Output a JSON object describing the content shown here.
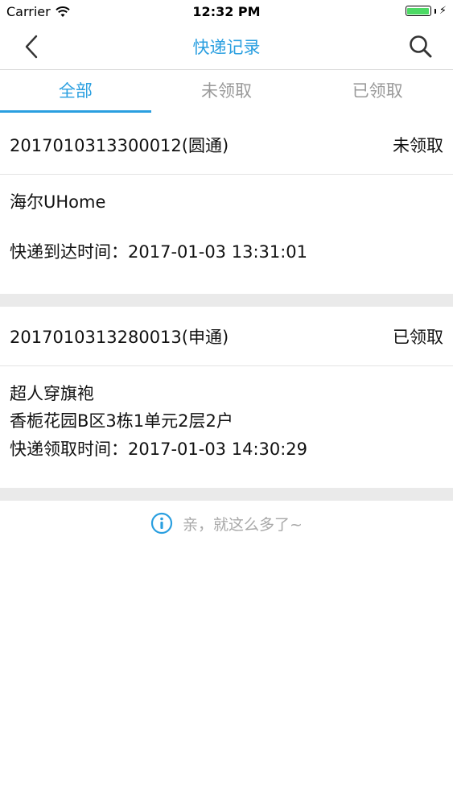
{
  "status_bar": {
    "carrier": "Carrier",
    "time": "12:32 PM"
  },
  "nav": {
    "title": "快递记录",
    "back_icon": "chevron-left-icon",
    "search_icon": "search-icon"
  },
  "tabs": [
    {
      "label": "全部",
      "active": true
    },
    {
      "label": "未领取",
      "active": false
    },
    {
      "label": "已领取",
      "active": false
    }
  ],
  "records": [
    {
      "id": "2017010313300012(圆通)",
      "status": "未领取",
      "name": "海尔UHome",
      "address": "",
      "time_label": "快递到达时间：",
      "time_value": "2017-01-03 13:31:01"
    },
    {
      "id": "2017010313280013(申通)",
      "status": "已领取",
      "name": "超人穿旗袍",
      "address": "香栀花园B区3栋1单元2层2户",
      "time_label": "快递领取时间：",
      "time_value": "2017-01-03 14:30:29"
    }
  ],
  "footer": {
    "end_text": "亲，就这么多了~",
    "icon": "info-icon"
  },
  "colors": {
    "accent": "#2a9fe0",
    "inactive_tab": "#9a9a9a",
    "separator": "#eaeaea",
    "battery": "#4cd964"
  }
}
